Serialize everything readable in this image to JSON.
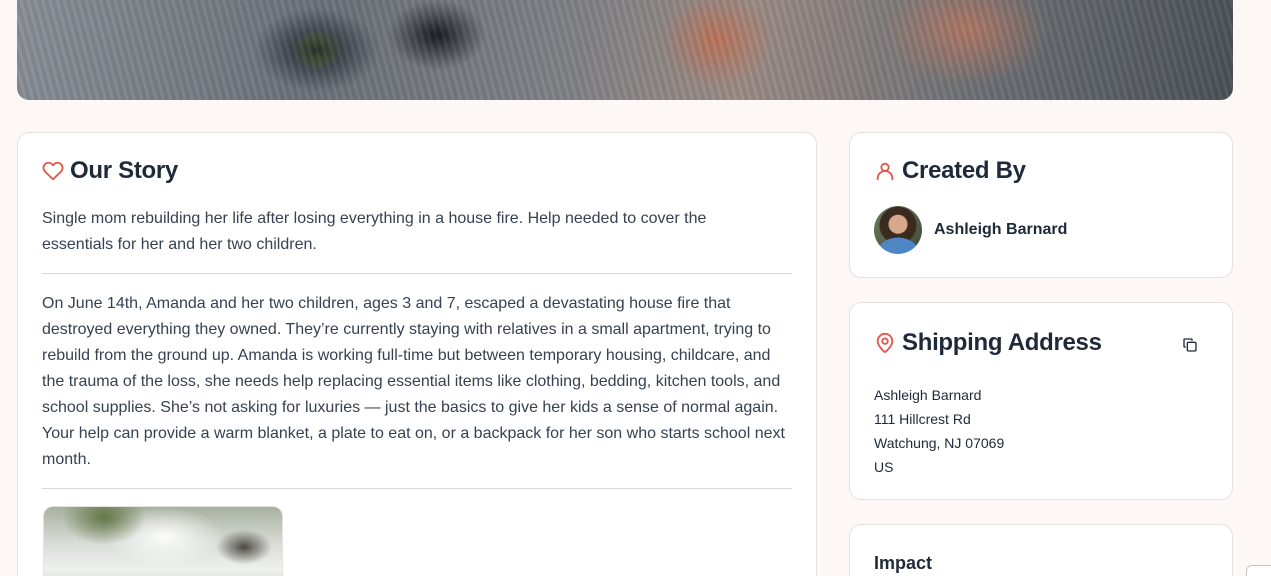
{
  "story": {
    "title": "Our Story",
    "summary": "Single mom rebuilding her life after losing everything in a house fire. Help needed to cover the essentials for her and her two children.",
    "body": "On June 14th, Amanda and her two children, ages 3 and 7, escaped a devastating house fire that destroyed everything they owned. They’re currently staying with relatives in a small apartment, trying to rebuild from the ground up. Amanda is working full-time but between temporary housing, childcare, and the trauma of the loss, she needs help replacing essential items like clothing, bedding, kitchen tools, and school supplies. She’s not asking for luxuries — just the basics to give her kids a sense of normal again. Your help can provide a warm blanket, a plate to eat on, or a backpack for her son who starts school next month."
  },
  "creator": {
    "title": "Created By",
    "name": "Ashleigh Barnard"
  },
  "shipping": {
    "title": "Shipping Address",
    "name": "Ashleigh Barnard",
    "street": "111 Hillcrest Rd",
    "city_line": "Watchung, NJ 07069",
    "country": "US"
  },
  "impact": {
    "title": "Impact"
  },
  "icons": {
    "story": "heart-icon",
    "creator": "user-icon",
    "shipping": "map-pin-icon",
    "copy": "copy-icon"
  },
  "colors": {
    "accent": "#e5534b",
    "background": "#fdf8f5",
    "card": "#ffffff",
    "text": "#1f2937"
  }
}
